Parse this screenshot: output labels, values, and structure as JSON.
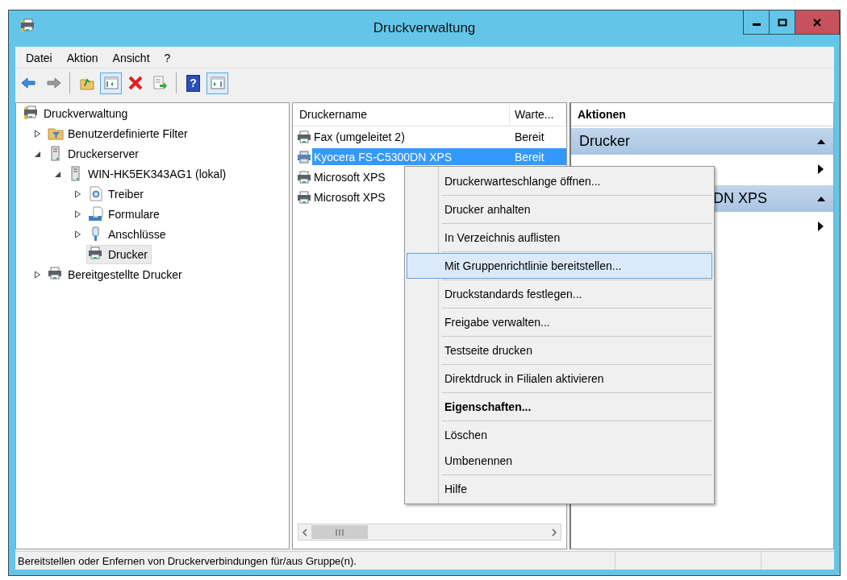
{
  "window": {
    "title": "Druckverwaltung"
  },
  "menu_bar": [
    "Datei",
    "Aktion",
    "Ansicht",
    "?"
  ],
  "toolbar": [
    {
      "kind": "back",
      "disabled": false,
      "pressed": false
    },
    {
      "kind": "forward",
      "disabled": true,
      "pressed": false
    },
    {
      "kind": "separator"
    },
    {
      "kind": "up",
      "disabled": false,
      "pressed": false
    },
    {
      "kind": "tree-toggle",
      "disabled": false,
      "pressed": true
    },
    {
      "kind": "delete",
      "disabled": false,
      "pressed": false
    },
    {
      "kind": "export",
      "disabled": false,
      "pressed": false
    },
    {
      "kind": "separator"
    },
    {
      "kind": "help",
      "glyph": "?",
      "disabled": false,
      "pressed": false
    },
    {
      "kind": "action-pane",
      "disabled": false,
      "pressed": true
    }
  ],
  "tree": [
    {
      "label": "Druckverwaltung",
      "kind": "console",
      "selected": false,
      "children": [
        {
          "label": "Benutzerdefinierte Filter",
          "kind": "filter",
          "expanded": false,
          "selected": false
        },
        {
          "label": "Druckerserver",
          "kind": "server",
          "expanded": true,
          "selected": false,
          "children": [
            {
              "label": "WIN-HK5EK343AG1 (lokal)",
              "kind": "server",
              "expanded": true,
              "selected": false,
              "children": [
                {
                  "label": "Treiber",
                  "kind": "drivers",
                  "expanded": false,
                  "selected": false
                },
                {
                  "label": "Formulare",
                  "kind": "forms",
                  "expanded": false,
                  "selected": false
                },
                {
                  "label": "Anschlüsse",
                  "kind": "ports",
                  "expanded": false,
                  "selected": false
                },
                {
                  "label": "Drucker",
                  "kind": "printer",
                  "selected": true
                }
              ]
            }
          ]
        },
        {
          "label": "Bereitgestellte Drucker",
          "kind": "printer",
          "expanded": false,
          "selected": false
        }
      ]
    }
  ],
  "list": {
    "columns": [
      "Druckername",
      "Warte..."
    ],
    "rows": [
      {
        "name": "Fax (umgeleitet 2)",
        "status": "Bereit",
        "selected": false
      },
      {
        "name": "Kyocera FS-C5300DN XPS",
        "status": "Bereit",
        "selected": true
      },
      {
        "name": "Microsoft XPS",
        "selected": false
      },
      {
        "name": "Microsoft XPS",
        "selected": false
      }
    ]
  },
  "actions": {
    "title": "Aktionen",
    "sections": [
      {
        "title": "Drucker",
        "expanded": true,
        "items": [
          {
            "submenu": true
          }
        ]
      },
      {
        "title": "DN XPS",
        "expanded": true,
        "items": [
          {
            "submenu": true
          }
        ]
      }
    ]
  },
  "context_menu": {
    "groups": [
      [
        {
          "label": "Druckerwarteschlange öffnen...",
          "selected": false,
          "default": false
        }
      ],
      [
        {
          "label": "Drucker anhalten",
          "selected": false,
          "default": false
        }
      ],
      [
        {
          "label": "In Verzeichnis auflisten",
          "selected": false,
          "default": false
        }
      ],
      [
        {
          "label": "Mit Gruppenrichtlinie bereitstellen...",
          "selected": true,
          "default": false
        }
      ],
      [
        {
          "label": "Druckstandards festlegen...",
          "selected": false,
          "default": false
        }
      ],
      [
        {
          "label": "Freigabe verwalten...",
          "selected": false,
          "default": false
        }
      ],
      [
        {
          "label": "Testseite drucken",
          "selected": false,
          "default": false
        }
      ],
      [
        {
          "label": "Direktdruck in Filialen aktivieren",
          "selected": false,
          "default": false
        }
      ],
      [
        {
          "label": "Eigenschaften...",
          "selected": false,
          "default": true
        }
      ],
      [
        {
          "label": "Löschen",
          "selected": false,
          "default": false
        },
        {
          "label": "Umbenennen",
          "selected": false,
          "default": false
        }
      ],
      [
        {
          "label": "Hilfe",
          "selected": false,
          "default": false
        }
      ]
    ]
  },
  "status_bar": {
    "text": "Bereitstellen oder Enfernen von Druckerverbindungen für/aus Gruppe(n)."
  }
}
